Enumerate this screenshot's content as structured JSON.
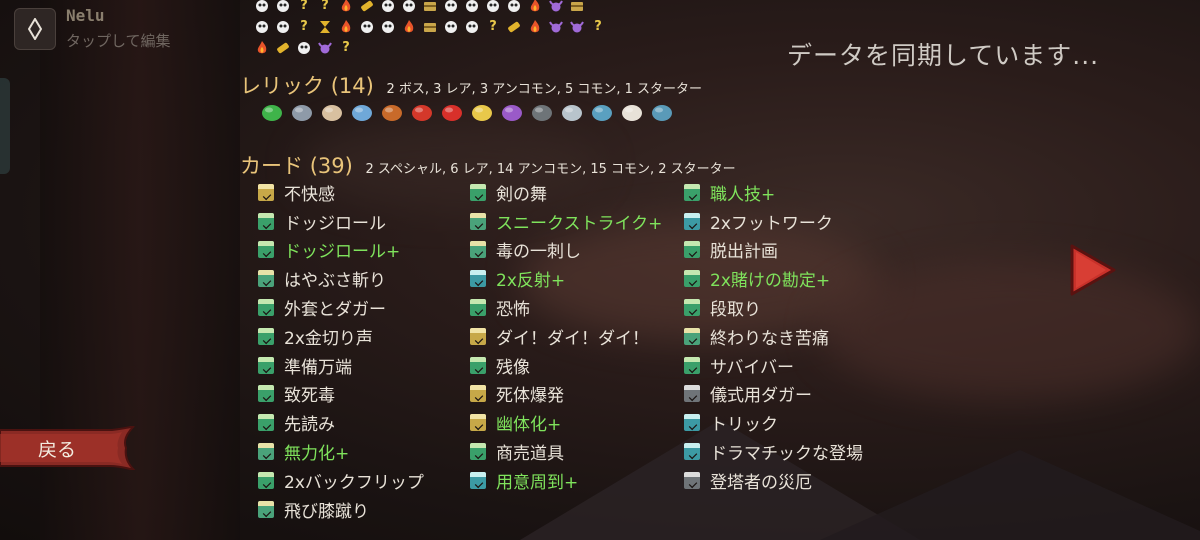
{
  "profile": {
    "name": "Nelu",
    "subtitle": "タップして編集"
  },
  "sync_status": "データを同期しています...",
  "potions": [
    [
      "skull",
      "skull",
      "?",
      "?",
      "fire",
      "gold",
      "skull",
      "skull",
      "chest",
      "skull",
      "skull",
      "skull",
      "skull",
      "fire",
      "bull",
      "chest"
    ],
    [
      "skull",
      "skull",
      "?",
      "hourglass",
      "fire",
      "skull",
      "skull",
      "fire",
      "chest",
      "skull",
      "skull",
      "?",
      "gold",
      "fire",
      "bull",
      "bull",
      "?"
    ],
    [
      "fire",
      "gold",
      "skull",
      "bull",
      "?"
    ]
  ],
  "relics_section": {
    "title": "レリック",
    "count": "(14)",
    "breakdown": "2 ボス, 3 レア, 3 アンコモン, 5 コモン, 1 スターター",
    "icons": [
      "ring-icon",
      "shuriken-icon",
      "scroll-icon",
      "pipe-icon",
      "kite-icon",
      "nunchaku-icon",
      "strawberry-icon",
      "paper-crane-icon",
      "tent-icon",
      "kettlebell-icon",
      "stone-icon",
      "bracelet-icon",
      "bird-skull-icon",
      "anvil-icon"
    ]
  },
  "cards_section": {
    "title": "カード",
    "count": "(39)",
    "breakdown": "2 スペシャル, 6 レア, 14 アンコモン, 15 コモン, 2 スターター",
    "columns": [
      [
        {
          "label": "不快感",
          "color": "gold",
          "upgraded": false
        },
        {
          "label": "ドッジロール",
          "color": "green",
          "upgraded": false
        },
        {
          "label": "ドッジロール+",
          "color": "green",
          "upgraded": true
        },
        {
          "label": "はやぶさ斬り",
          "color": "red",
          "upgraded": false
        },
        {
          "label": "外套とダガー",
          "color": "green",
          "upgraded": false
        },
        {
          "label": "2x金切り声",
          "color": "green",
          "upgraded": false
        },
        {
          "label": "準備万端",
          "color": "green",
          "upgraded": false
        },
        {
          "label": "致死毒",
          "color": "green",
          "upgraded": false
        },
        {
          "label": "先読み",
          "color": "green",
          "upgraded": false
        },
        {
          "label": "無力化+",
          "color": "red",
          "upgraded": true
        },
        {
          "label": "2xバックフリップ",
          "color": "green",
          "upgraded": false
        },
        {
          "label": "飛び膝蹴り",
          "color": "red",
          "upgraded": false
        }
      ],
      [
        {
          "label": "剣の舞",
          "color": "green",
          "upgraded": false
        },
        {
          "label": "スニークストライク+",
          "color": "red",
          "upgraded": true
        },
        {
          "label": "毒の一刺し",
          "color": "red",
          "upgraded": false
        },
        {
          "label": "2x反射+",
          "color": "blue",
          "upgraded": true
        },
        {
          "label": "恐怖",
          "color": "green",
          "upgraded": false
        },
        {
          "label": "ダイ！ダイ！ダイ！",
          "color": "gold",
          "upgraded": false
        },
        {
          "label": "残像",
          "color": "green",
          "upgraded": false
        },
        {
          "label": "死体爆発",
          "color": "gold",
          "upgraded": false
        },
        {
          "label": "幽体化+",
          "color": "gold",
          "upgraded": true
        },
        {
          "label": "商売道具",
          "color": "green",
          "upgraded": false
        },
        {
          "label": "用意周到+",
          "color": "blue",
          "upgraded": true
        }
      ],
      [
        {
          "label": "職人技+",
          "color": "green",
          "upgraded": true
        },
        {
          "label": "2xフットワーク",
          "color": "blue",
          "upgraded": false
        },
        {
          "label": "脱出計画",
          "color": "green",
          "upgraded": false
        },
        {
          "label": "2x賭けの勘定+",
          "color": "green",
          "upgraded": true
        },
        {
          "label": "段取り",
          "color": "green",
          "upgraded": false
        },
        {
          "label": "終わりなき苦痛",
          "color": "red",
          "upgraded": false
        },
        {
          "label": "サバイバー",
          "color": "green",
          "upgraded": false
        },
        {
          "label": "儀式用ダガー",
          "color": "gray",
          "upgraded": false
        },
        {
          "label": "トリック",
          "color": "blue",
          "upgraded": false
        },
        {
          "label": "ドラマチックな登場",
          "color": "blue",
          "upgraded": false
        },
        {
          "label": "登塔者の災厄",
          "color": "gray",
          "upgraded": false
        }
      ]
    ]
  },
  "back_button": "戻る",
  "colors": {
    "accent": "#e9c47a",
    "upgraded": "#7fe35c",
    "arrow": "#c8312a"
  }
}
